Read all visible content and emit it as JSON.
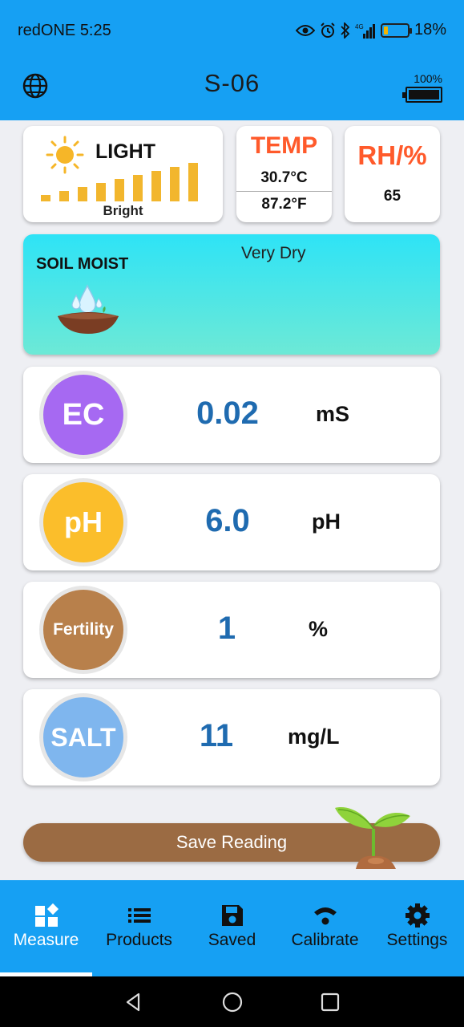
{
  "status_bar": {
    "carrier": "redONE",
    "time": "5:25",
    "network": "4G",
    "battery_pct_text": "18%",
    "battery_level": 0.18,
    "icons": [
      "eye-icon",
      "alarm-icon",
      "bluetooth-icon",
      "signal-icon",
      "battery-icon"
    ]
  },
  "app_bar": {
    "title": "S-06",
    "device_battery_text": "100%",
    "device_battery_level": 1.0,
    "left_icon": "globe-icon"
  },
  "light": {
    "title": "LIGHT",
    "level_text": "Bright",
    "bar_levels": 9,
    "color": "#f2b62d"
  },
  "temp": {
    "title": "TEMP",
    "celsius": "30.7°C",
    "fahrenheit": "87.2°F",
    "title_color": "#ff5a2b"
  },
  "rh": {
    "title": "RH/%",
    "value": "65"
  },
  "soil": {
    "title": "SOIL MOIST",
    "status": "Very Dry"
  },
  "meters": [
    {
      "badge": "EC",
      "value": "0.02",
      "unit": "mS",
      "color": "#a669f2"
    },
    {
      "badge": "pH",
      "value": "6.0",
      "unit": "pH",
      "color": "#fbbe2b"
    },
    {
      "badge": "Fertility",
      "value": "1",
      "unit": "%",
      "color": "#b8804b"
    },
    {
      "badge": "SALT",
      "value": "11",
      "unit": "mg/L",
      "color": "#7fb6ee"
    }
  ],
  "save_button": {
    "label": "Save Reading"
  },
  "bottom_nav": [
    {
      "label": "Measure",
      "icon": "measure-icon",
      "active": true
    },
    {
      "label": "Products",
      "icon": "list-icon",
      "active": false
    },
    {
      "label": "Saved",
      "icon": "save-icon",
      "active": false
    },
    {
      "label": "Calibrate",
      "icon": "calibrate-icon",
      "active": false
    },
    {
      "label": "Settings",
      "icon": "gear-icon",
      "active": false
    }
  ],
  "android_nav": [
    "back-icon",
    "home-icon",
    "recents-icon"
  ],
  "colors": {
    "primary": "#16a0f3",
    "value_blue": "#1f6bb0",
    "save_brown": "#9b6b43",
    "soil_gradient_top": "#2ee3f6",
    "soil_gradient_bottom": "#6de9d6"
  }
}
